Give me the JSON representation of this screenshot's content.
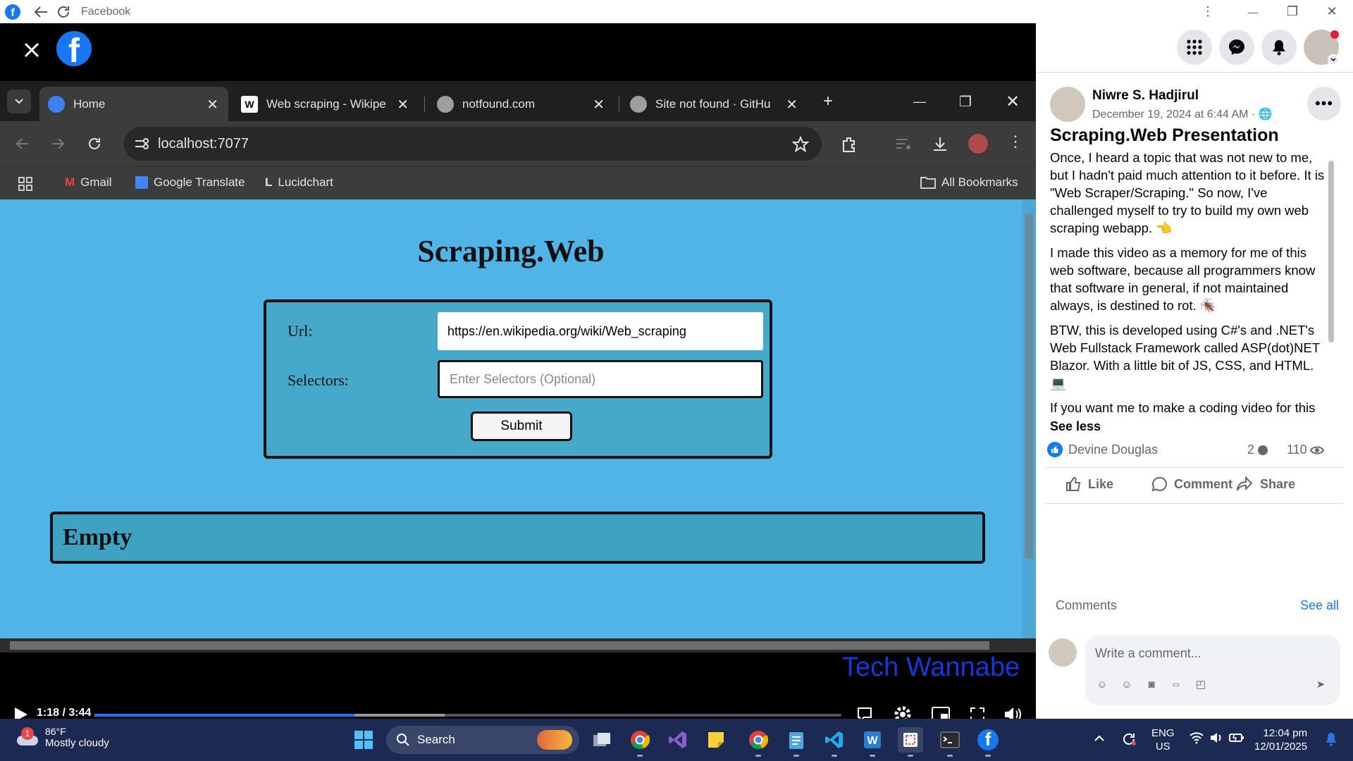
{
  "window": {
    "title": "Facebook",
    "more_glyph": "⋮",
    "minimize_glyph": "—",
    "restore_glyph": "❐",
    "close_glyph": "✕"
  },
  "browser": {
    "tabs": [
      {
        "label": "Home",
        "icon": "globe-icon",
        "active": true
      },
      {
        "label": "Web scraping - Wikipe",
        "icon": "wikipedia-icon",
        "active": false
      },
      {
        "label": "notfound.com",
        "icon": "globe-icon",
        "active": false
      },
      {
        "label": "Site not found · GitHu",
        "icon": "globe-icon",
        "active": false
      }
    ],
    "url": "localhost:7077",
    "bookmarks": [
      {
        "label": "Gmail",
        "icon": "gmail-icon"
      },
      {
        "label": "Google Translate",
        "icon": "translate-icon"
      },
      {
        "label": "Lucidchart",
        "icon": "lucidchart-icon"
      }
    ],
    "all_bookmarks": "All Bookmarks"
  },
  "webpage": {
    "heading": "Scraping.Web",
    "url_label": "Url:",
    "url_value": "https://en.wikipedia.org/wiki/Web_scraping",
    "selectors_label": "Selectors:",
    "selectors_placeholder": "Enter Selectors (Optional)",
    "submit_label": "Submit",
    "result_text": "Empty"
  },
  "video": {
    "watermark": "Tech Wannabe",
    "time": "1:18 / 3:44",
    "progress": 0.349,
    "buffered": 0.469
  },
  "post": {
    "author": "Niwre S. Hadjirul",
    "date": "December 19, 2024 at 6:44 AM · ",
    "title": "Scraping.Web Presentation",
    "paragraphs": [
      "Once, I heard a topic that was not new to me, but I hadn't paid much attention to it before. It is \"Web Scraper/Scraping.\" So now, I've challenged myself to try to build my own web scraping webapp. 👈",
      "I made this video as a memory for me of this web software, because all programmers know that software in general, if not maintained always, is destined to rot. 🪳",
      "BTW, this is developed using C#'s and .NET's Web Fullstack Framework called ASP(dot)NET Blazor. With a little bit of JS, CSS, and HTML. 💻",
      "If you want me to make a coding video for this"
    ],
    "see_less": "See less",
    "reactor": "Devine Douglas",
    "comment_count": "2",
    "view_count": "110",
    "actions": {
      "like": "Like",
      "comment": "Comment",
      "share": "Share"
    },
    "comments_label": "Comments",
    "see_all": "See all",
    "comment_placeholder": "Write a comment..."
  },
  "taskbar": {
    "weather_badge": "1",
    "weather_temp": "86°F",
    "weather_desc": "Mostly cloudy",
    "search_label": "Search",
    "language": "ENG",
    "region": "US",
    "time": "12:04 pm",
    "date": "12/01/2025"
  },
  "colors": {
    "facebook_blue": "#1877f2",
    "page_background": "#50b4e6",
    "taskbar": "#1c2a52",
    "watermark": "#1638d9"
  }
}
